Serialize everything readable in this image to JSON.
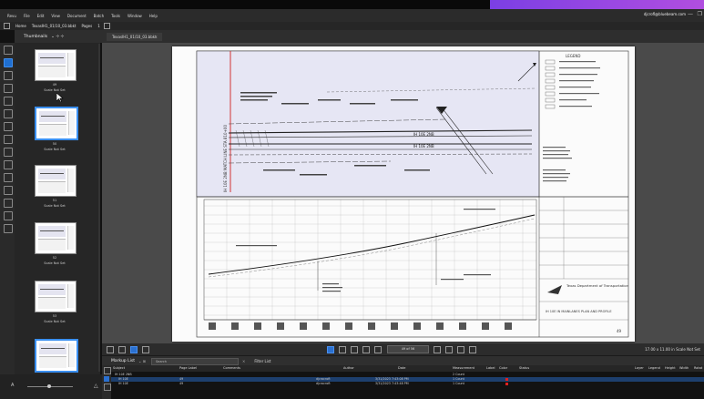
{
  "window": {
    "menu": [
      "Revu",
      "File",
      "Edit",
      "View",
      "Document",
      "Batch",
      "Tools",
      "Window",
      "Help"
    ],
    "user": "djcrofl@bluebeam.com",
    "controls": [
      "—",
      "❐"
    ]
  },
  "toolbar": {
    "home_label": "Home",
    "doc_label": "TexasIH1_01/10_03.bbkt",
    "pages_label": "Pages",
    "pages_value": "1"
  },
  "thumbnails": {
    "header": "Thumbnails",
    "items": [
      {
        "label": "Scale Not Set",
        "page": "49"
      },
      {
        "label": "Scale Not Set",
        "page": "50"
      },
      {
        "label": "Scale Not Set",
        "page": "51"
      },
      {
        "label": "Scale Not Set",
        "page": "52"
      },
      {
        "label": "Scale Not Set",
        "page": "53"
      },
      {
        "label": "Scale Not Set",
        "page": "54"
      }
    ]
  },
  "tab": {
    "label": "TexasIH1_01/10_03.bbkt"
  },
  "drawing": {
    "legend_title": "LEGEND",
    "main_label_1": "IH 10E 2NB",
    "main_label_2": "IH 10E 2NB",
    "station_label": "IH 10E 2NB MATCH LINE STA 810+00",
    "dept_name": "Texas Department of Transportation",
    "sheet_title": "IH 10E IN MAINLANES PLAN AND PROFILE",
    "sheet_no": "49"
  },
  "navbar": {
    "page_box": "49 of 56",
    "dims": "17.00 x 11.00 in",
    "scale": "Scale Not Set"
  },
  "markup_list": {
    "title": "Markup List",
    "search_placeholder": "Search",
    "filter_label": "Filter List",
    "columns": [
      "Subject",
      "Page Label",
      "Comments",
      "Author",
      "Date",
      "Measurement",
      "Label",
      "Color",
      "Status",
      "Layer",
      "Legend",
      "Height",
      "Width",
      "Rotat"
    ],
    "rows": [
      {
        "subject": "IH 10E 2NB",
        "page": "",
        "comments": "",
        "author": "",
        "date": "",
        "measurement": "2 Count",
        "color": ""
      },
      {
        "subject": "IH 10E",
        "page": "49",
        "comments": "",
        "author": "djcrocroft",
        "date": "3/31/2023 7:43:08 PM",
        "measurement": "1 Count",
        "color": "#e02020"
      },
      {
        "subject": "IH 10E",
        "page": "49",
        "comments": "",
        "author": "djcrocroft",
        "date": "3/31/2023 7:43:48 PM",
        "measurement": "1 Count",
        "color": "#e02020"
      }
    ]
  },
  "colors": {
    "accent": "#2a70d0",
    "brand_gradient_start": "#7b3fe4",
    "brand_gradient_end": "#b14ee0",
    "count_marker": "#e02020"
  }
}
